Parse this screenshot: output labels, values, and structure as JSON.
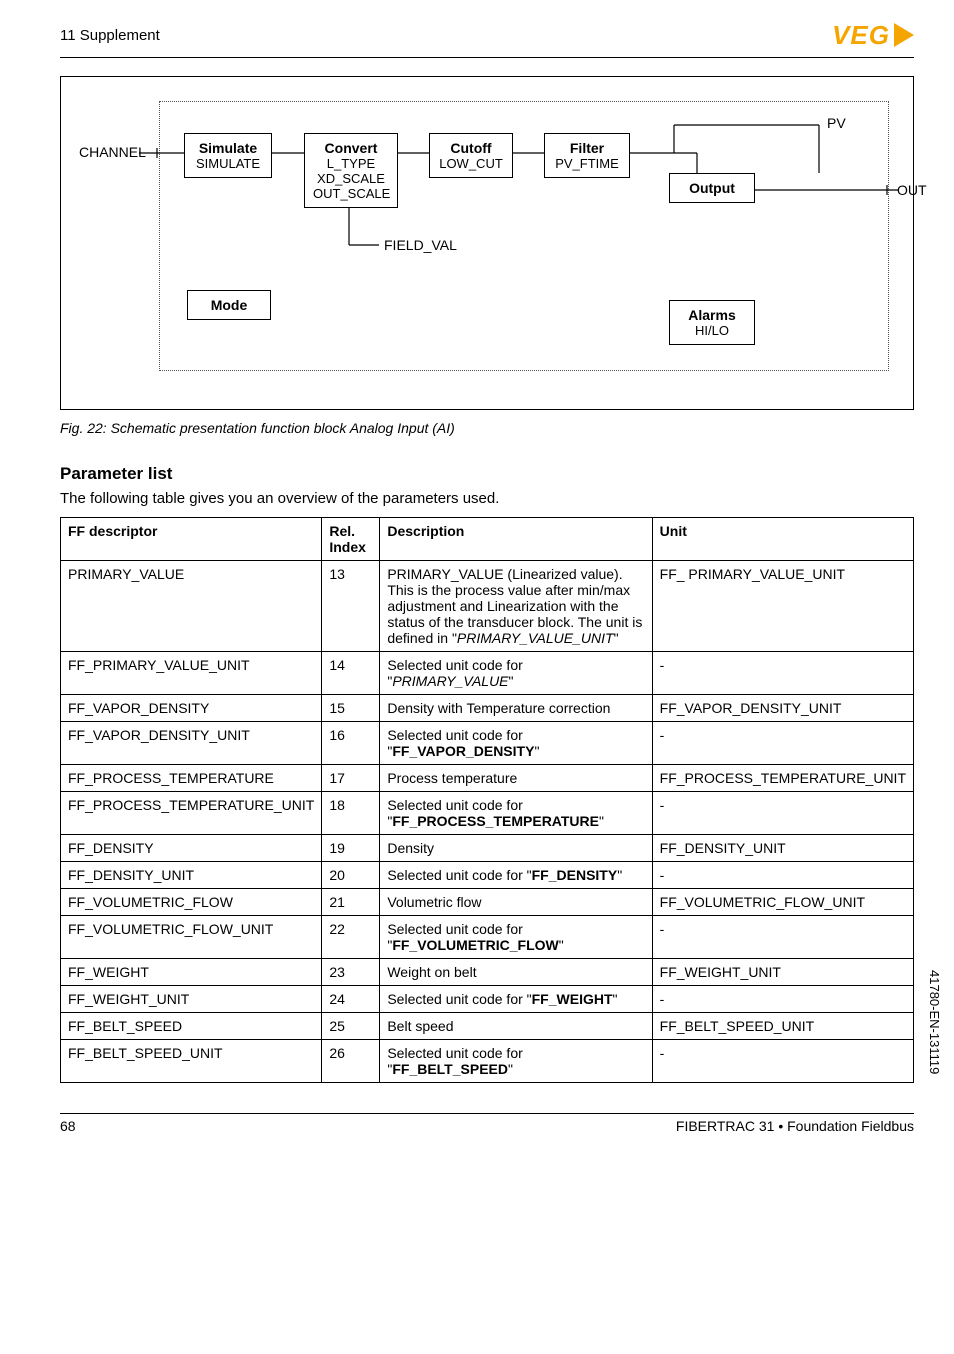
{
  "header": {
    "section": "11 Supplement",
    "logo_text": "VEG"
  },
  "diagram": {
    "channel": "CHANNEL",
    "simulate": {
      "top": "Simulate",
      "bot": "SIMULATE"
    },
    "convert": {
      "top": "Convert",
      "bot": "L_TYPE\nXD_SCALE\nOUT_SCALE"
    },
    "cutoff": {
      "top": "Cutoff",
      "bot": "LOW_CUT"
    },
    "filter": {
      "top": "Filter",
      "bot": "PV_FTIME"
    },
    "output": {
      "top": "Output"
    },
    "alarms": {
      "top": "Alarms",
      "bot": "HI/LO"
    },
    "mode": "Mode",
    "field_val": "FIELD_VAL",
    "pv": "PV",
    "out": "OUT"
  },
  "fig_caption": "Fig. 22: Schematic presentation function block Analog Input (AI)",
  "param_title": "Parameter list",
  "param_intro": "The following table gives you an overview of the parameters used.",
  "table": {
    "headers": {
      "ff": "FF descriptor",
      "idx": "Rel. Index",
      "desc": "Description",
      "unit": "Unit"
    }
  },
  "chart_data": {
    "type": "table",
    "columns": [
      "FF descriptor",
      "Rel. Index",
      "Description",
      "Unit"
    ],
    "rows": [
      {
        "ff": "PRIMARY_VALUE",
        "idx": "13",
        "desc": "PRIMARY_VALUE (Linearized value). This is the process value after min/max adjustment and Linearization with the status of the transducer block. The unit is defined in \"PRIMARY_VALUE_UNIT\"",
        "unit": "FF_ PRIMARY_VALUE_UNIT",
        "italic_segment": "PRIMARY_VALUE_UNIT"
      },
      {
        "ff": "FF_PRIMARY_VALUE_UNIT",
        "idx": "14",
        "desc": "Selected unit code for \"PRIMARY_VALUE\"",
        "unit": "-",
        "italic_segment": "PRIMARY_VALUE"
      },
      {
        "ff": "FF_VAPOR_DENSITY",
        "idx": "15",
        "desc": "Density with Temperature correction",
        "unit": "FF_VAPOR_DENSITY_UNIT"
      },
      {
        "ff": "FF_VAPOR_DENSITY_UNIT",
        "idx": "16",
        "desc": "Selected unit code for \"FF_VAPOR_DENSITY\"",
        "unit": "-",
        "bold_segment": "FF_VAPOR_DENSITY"
      },
      {
        "ff": "FF_PROCESS_TEMPERATURE",
        "idx": "17",
        "desc": "Process temperature",
        "unit": "FF_PROCESS_TEMPERATURE_UNIT"
      },
      {
        "ff": "FF_PROCESS_TEMPERATURE_UNIT",
        "idx": "18",
        "desc": "Selected unit code for \"FF_PROCESS_TEMPERATURE\"",
        "unit": "-",
        "bold_segment": "FF_PROCESS_TEMPERATURE"
      },
      {
        "ff": "FF_DENSITY",
        "idx": "19",
        "desc": "Density",
        "unit": "FF_DENSITY_UNIT"
      },
      {
        "ff": "FF_DENSITY_UNIT",
        "idx": "20",
        "desc": "Selected unit code for \"FF_DENSITY\"",
        "unit": "-",
        "bold_segment": "FF_DENSITY"
      },
      {
        "ff": "FF_VOLUMETRIC_FLOW",
        "idx": "21",
        "desc": "Volumetric flow",
        "unit": "FF_VOLUMETRIC_FLOW_UNIT"
      },
      {
        "ff": "FF_VOLUMETRIC_FLOW_UNIT",
        "idx": "22",
        "desc": "Selected unit code for \"FF_VOLUMETRIC_FLOW\"",
        "unit": "-",
        "bold_segment": "FF_VOLUMETRIC_FLOW"
      },
      {
        "ff": "FF_WEIGHT",
        "idx": "23",
        "desc": "Weight on belt",
        "unit": "FF_WEIGHT_UNIT"
      },
      {
        "ff": "FF_WEIGHT_UNIT",
        "idx": "24",
        "desc": "Selected unit code for \"FF_WEIGHT\"",
        "unit": "-",
        "bold_segment": "FF_WEIGHT"
      },
      {
        "ff": "FF_BELT_SPEED",
        "idx": "25",
        "desc": "Belt speed",
        "unit": "FF_BELT_SPEED_UNIT"
      },
      {
        "ff": "FF_BELT_SPEED_UNIT",
        "idx": "26",
        "desc": "Selected unit code for \"FF_BELT_SPEED\"",
        "unit": "-",
        "bold_segment": "FF_BELT_SPEED"
      }
    ]
  },
  "footer": {
    "page": "68",
    "doc": "FIBERTRAC 31 • Foundation Fieldbus"
  },
  "side_doc_id": "41780-EN-131119"
}
